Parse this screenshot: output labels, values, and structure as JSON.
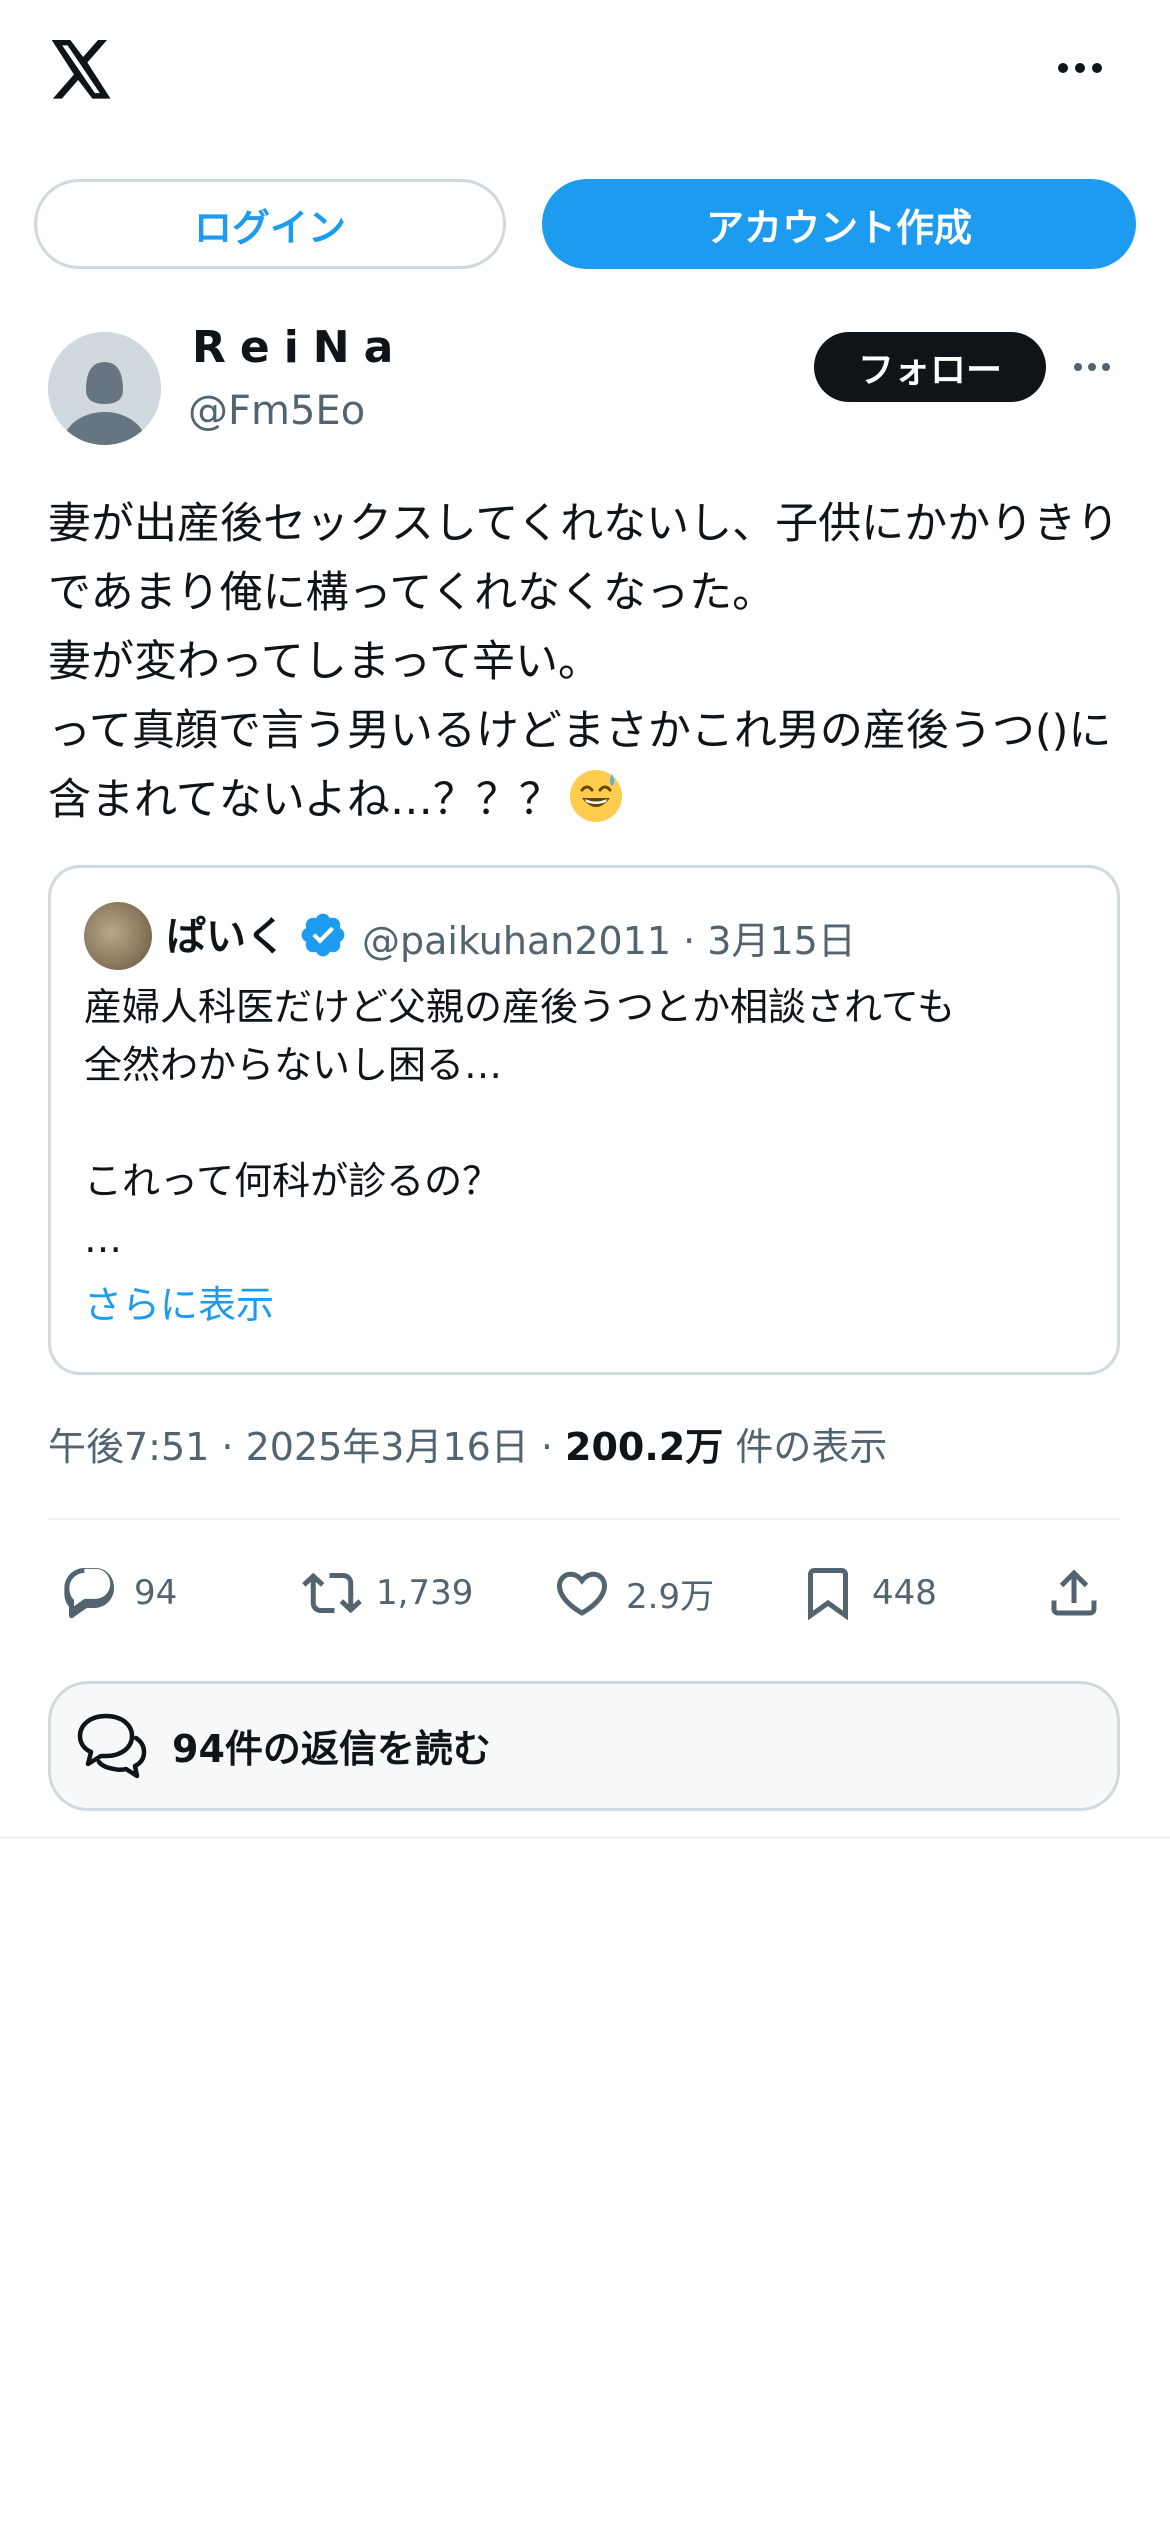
{
  "header": {
    "logo_icon": "x-logo-icon",
    "more_icon": "more-horizontal-icon",
    "login_label": "ログイン",
    "create_account_label": "アカウント作成"
  },
  "post": {
    "author": {
      "display_name": "ReiNa",
      "handle": "@Fm5Eo",
      "avatar_icon": "default-avatar-icon"
    },
    "follow_label": "フォロー",
    "text": "妻が出産後セックスしてくれないし、子供にかかりきりであまり俺に構ってくれなくなった。\n妻が変わってしまって辛い。\nって真顔で言う男いるけどまさかこれ男の産後うつ()に含まれてないよね…？？？",
    "emoji_icon": "grinning-sweat-emoji",
    "quote": {
      "name": "ぱいく",
      "verified_icon": "verified-badge-icon",
      "handle_date": "@paikuhan2011 · 3月15日",
      "text": "産婦人科医だけど父親の産後うつとか相談されても\n全然わからないし困る…\n\nこれって何科が診るの？\n…",
      "show_more": "さらに表示"
    },
    "meta": {
      "time_date": "午後7:51 · 2025年3月16日 · ",
      "views": "200.2万",
      "views_label": " 件の表示"
    },
    "actions": {
      "reply_count": "94",
      "retweet_count": "1,739",
      "like_count": "2.9万",
      "bookmark_count": "448"
    },
    "read_replies_label": "94件の返信を読む"
  },
  "colors": {
    "accent": "#1d9bf0",
    "text": "#0f1419",
    "secondary": "#536471",
    "border": "#cfd9de"
  }
}
